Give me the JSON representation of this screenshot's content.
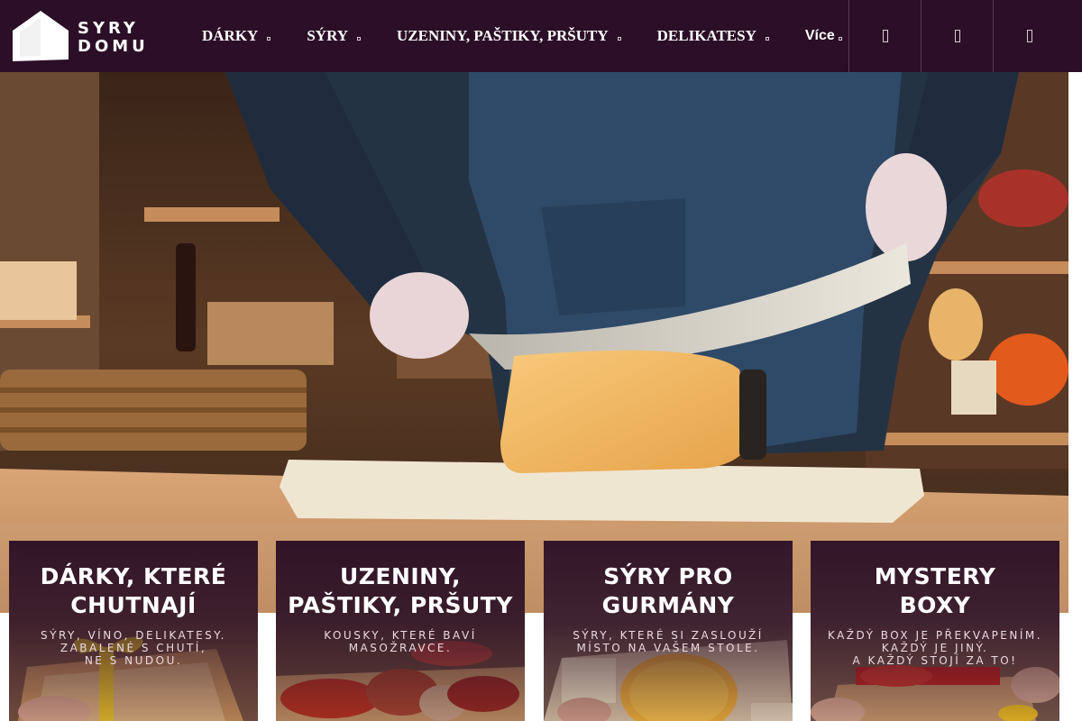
{
  "header": {
    "logo": {
      "line1": "SYRY",
      "line2": "DOMU"
    },
    "nav": [
      {
        "label": "DÁRKY"
      },
      {
        "label": "SÝRY"
      },
      {
        "label": "UZENINY, PAŠTIKY, PRŠUTY"
      },
      {
        "label": "DELIKATESY"
      },
      {
        "label": "Více"
      }
    ],
    "icons": [
      "search-icon",
      "user-icon",
      "cart-icon"
    ]
  },
  "cards": [
    {
      "title_line1": "DÁRKY, KTERÉ",
      "title_line2": "CHUTNAJÍ",
      "sub_line1": "SÝRY, VÍNO, DELIKATESY.",
      "sub_line2": "ZABALENÉ S CHUTÍ,",
      "sub_line3": "NE S NUDOU."
    },
    {
      "title_line1": "UZENINY,",
      "title_line2": "PAŠTIKY, PRŠUTY",
      "sub_line1": "KOUSKY, KTERÉ BAVÍ",
      "sub_line2": "MASOŽRAVCE.",
      "sub_line3": ""
    },
    {
      "title_line1": "SÝRY PRO",
      "title_line2": "GURMÁNY",
      "sub_line1": "SÝRY, KTERÉ SI ZASLOUŽÍ",
      "sub_line2": "MÍSTO NA VAŠEM STOLE.",
      "sub_line3": ""
    },
    {
      "title_line1": "MYSTERY",
      "title_line2": "BOXY",
      "sub_line1": "KAŽDÝ BOX JE PŘEKVAPENÍM.",
      "sub_line2": "KAŽDÝ JE JINÝ.",
      "sub_line3": "A KAŽDÝ STOJÍ ZA TO!"
    }
  ],
  "colors": {
    "header_bg": "#2b0f26",
    "card_overlay": "#2b0f26",
    "text": "#ffffff"
  }
}
